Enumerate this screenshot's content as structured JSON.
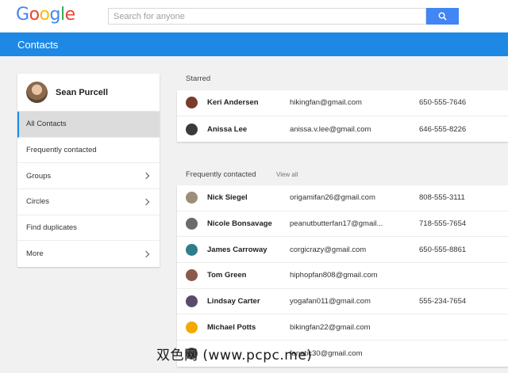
{
  "header": {
    "logo_text": "Google",
    "logo_letters": [
      {
        "ch": "G",
        "color": "#4285f4"
      },
      {
        "ch": "o",
        "color": "#ea4335"
      },
      {
        "ch": "o",
        "color": "#fbbc05"
      },
      {
        "ch": "g",
        "color": "#4285f4"
      },
      {
        "ch": "l",
        "color": "#34a853"
      },
      {
        "ch": "e",
        "color": "#ea4335"
      }
    ],
    "search_placeholder": "Search for anyone",
    "search_icon": "search-icon"
  },
  "appbar": {
    "title": "Contacts",
    "color": "#1e88e5"
  },
  "sidebar": {
    "profile_name": "Sean Purcell",
    "items": [
      {
        "label": "All Contacts",
        "active": true,
        "chevron": false
      },
      {
        "label": "Frequently contacted",
        "active": false,
        "chevron": false
      },
      {
        "label": "Groups",
        "active": false,
        "chevron": true
      },
      {
        "label": "Circles",
        "active": false,
        "chevron": true
      },
      {
        "label": "Find duplicates",
        "active": false,
        "chevron": false
      },
      {
        "label": "More",
        "active": false,
        "chevron": true
      }
    ]
  },
  "starred": {
    "title": "Starred",
    "contacts": [
      {
        "name": "Keri Andersen",
        "email": "hikingfan@gmail.com",
        "phone": "650-555-7646",
        "avatar_color": "#7a3b2e"
      },
      {
        "name": "Anissa Lee",
        "email": "anissa.v.lee@gmail.com",
        "phone": "646-555-8226",
        "avatar_color": "#3a3a3a"
      }
    ]
  },
  "frequent": {
    "title": "Frequently contacted",
    "view_all": "View all",
    "contacts": [
      {
        "name": "Nick Siegel",
        "email": "origamifan26@gmail.com",
        "phone": "808-555-3111",
        "avatar_color": "#9a8f7a"
      },
      {
        "name": "Nicole Bonsavage",
        "email": "peanutbutterfan17@gmail...",
        "phone": "718-555-7654",
        "avatar_color": "#6b6b6b"
      },
      {
        "name": "James Carroway",
        "email": "corgicrazy@gmail.com",
        "phone": "650-555-8861",
        "avatar_color": "#2e7d8c"
      },
      {
        "name": "Tom Green",
        "email": "hiphopfan808@gmail.com",
        "phone": "",
        "avatar_color": "#8a5a4a"
      },
      {
        "name": "Lindsay Carter",
        "email": "yogafan011@gmail.com",
        "phone": "555-234-7654",
        "avatar_color": "#5a4a6a"
      },
      {
        "name": "Michael Potts",
        "email": "bikingfan22@gmail.com",
        "phone": "",
        "avatar_color": "#f2a900"
      },
      {
        "name": "",
        "email": "fanatic30@gmail.com",
        "phone": "",
        "avatar_color": "#555555"
      }
    ]
  },
  "watermark": "双色网 (www.pcpc.me)"
}
